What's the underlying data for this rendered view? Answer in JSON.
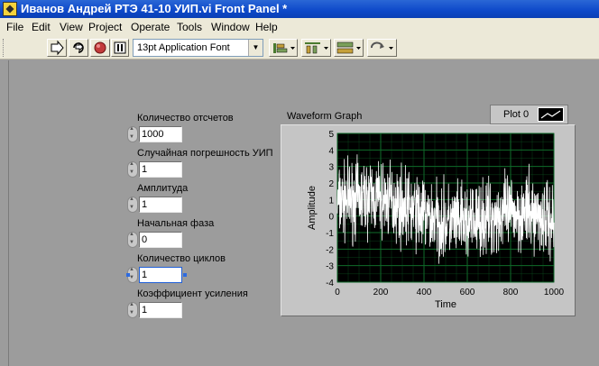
{
  "window": {
    "title": "Иванов Андрей РТЭ 41-10 УИП.vi Front Panel *"
  },
  "menu": [
    {
      "label": "File"
    },
    {
      "label": "Edit"
    },
    {
      "label": "View"
    },
    {
      "label": "Project"
    },
    {
      "label": "Operate"
    },
    {
      "label": "Tools"
    },
    {
      "label": "Window"
    },
    {
      "label": "Help"
    }
  ],
  "toolbar": {
    "font_select": "13pt Application Font",
    "icons": [
      "run-arrow-icon",
      "run-continuously-icon",
      "abort-stop-icon",
      "pause-icon",
      "align-objects-icon",
      "distribute-objects-icon",
      "resize-objects-icon",
      "reorder-icon"
    ]
  },
  "controls": [
    {
      "label": "Количество отсчетов",
      "value": "1000"
    },
    {
      "label": "Случайная погрешность УИП",
      "value": "1"
    },
    {
      "label": "Амплитуда",
      "value": "1"
    },
    {
      "label": "Начальная фаза",
      "value": "0"
    },
    {
      "label": "Количество циклов",
      "value": "1"
    },
    {
      "label": "Коэффициент усиления",
      "value": "1"
    }
  ],
  "graph": {
    "label": "Waveform Graph",
    "legend": {
      "plot_name": "Plot 0"
    }
  },
  "chart_data": {
    "type": "line",
    "xlabel": "Time",
    "ylabel": "Amplitude",
    "xlim": [
      0,
      1000
    ],
    "ylim": [
      -4,
      5
    ],
    "xticks": [
      "0",
      "200",
      "400",
      "600",
      "800",
      "1000"
    ],
    "yticks": [
      "5",
      "4",
      "3",
      "2",
      "1",
      "0",
      "-1",
      "-2",
      "-3",
      "-4"
    ],
    "grid": true,
    "series": [
      {
        "name": "Plot 0",
        "samples": 1000,
        "shape": "noisy signal, mean decreasing from about 0.8 to about -0.5, random spread of about ±2.5",
        "color": "#ffffff"
      }
    ],
    "colors": {
      "plot_bg": "#000000",
      "grid": "#0f6b2a",
      "trace": "#ffffff"
    }
  }
}
